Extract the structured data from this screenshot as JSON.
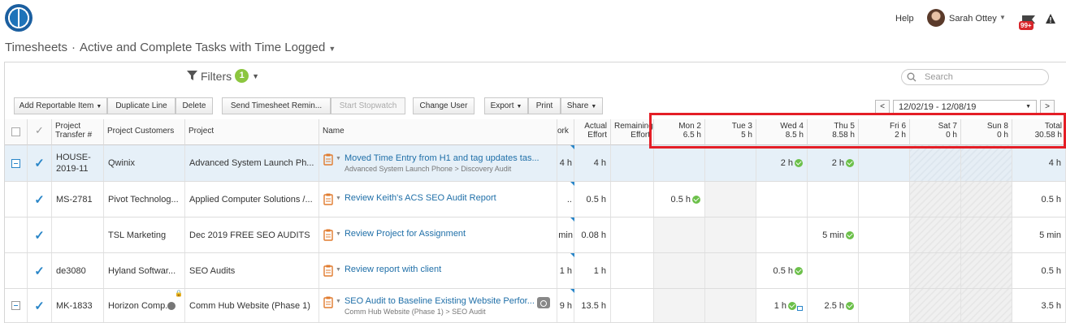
{
  "header": {
    "help": "Help",
    "user_name": "Sarah Ottey",
    "notif_badge": "99+"
  },
  "title": {
    "main": "Timesheets",
    "sep": "·",
    "view": "Active and Complete Tasks with Time Logged"
  },
  "filters": {
    "label": "Filters",
    "count": "1"
  },
  "search": {
    "placeholder": "Search"
  },
  "toolbar": {
    "add_reportable": "Add Reportable Item",
    "duplicate": "Duplicate Line",
    "delete": "Delete",
    "send_reminder": "Send Timesheet Remin...",
    "start_stopwatch": "Start Stopwatch",
    "change_user": "Change User",
    "export": "Export",
    "print": "Print",
    "share": "Share"
  },
  "date_range": {
    "value": "12/02/19 - 12/08/19",
    "prev": "<",
    "next": ">"
  },
  "columns": {
    "transfer": "Project Transfer #",
    "customers": "Project Customers",
    "project": "Project",
    "name": "Name",
    "work": "ork",
    "actual": "Actual Effort",
    "remaining": "Remaining Effort",
    "days": [
      {
        "day": "Mon 2",
        "hours": "6.5 h"
      },
      {
        "day": "Tue 3",
        "hours": "5 h"
      },
      {
        "day": "Wed 4",
        "hours": "8.5 h"
      },
      {
        "day": "Thu 5",
        "hours": "8.58 h"
      },
      {
        "day": "Fri 6",
        "hours": "2 h"
      },
      {
        "day": "Sat 7",
        "hours": "0 h"
      },
      {
        "day": "Sun 8",
        "hours": "0 h"
      },
      {
        "day": "Total",
        "hours": "30.58 h"
      }
    ]
  },
  "rows": [
    {
      "transfer": "HOUSE-2019-11",
      "customer": "Qwinix",
      "project": "Advanced System Launch Ph...",
      "name": "Moved Time Entry from H1 and tag updates tas...",
      "sub": "Advanced System Launch Phone > Discovery Audit",
      "work": "4 h",
      "actual": "4 h",
      "remaining": "",
      "days": [
        "",
        "",
        "2 h",
        "2 h",
        "",
        "",
        ""
      ],
      "total": "4 h"
    },
    {
      "transfer": "MS-2781",
      "customer": "Pivot Technolog...",
      "project": "Applied Computer Solutions /...",
      "name": "Review Keith's ACS SEO Audit Report",
      "sub": "",
      "work": "..",
      "actual": "0.5 h",
      "remaining": "",
      "days": [
        "0.5 h",
        "",
        "",
        "",
        "",
        "",
        ""
      ],
      "total": "0.5 h"
    },
    {
      "transfer": "",
      "customer": "TSL Marketing",
      "project": "Dec 2019 FREE SEO AUDITS",
      "name": "Review Project for Assignment",
      "sub": "",
      "work": "min",
      "actual": "0.08 h",
      "remaining": "",
      "days": [
        "",
        "",
        "",
        "5 min",
        "",
        "",
        ""
      ],
      "total": "5 min"
    },
    {
      "transfer": "de3080",
      "customer": "Hyland Softwar...",
      "project": "SEO Audits",
      "name": "Review report with client",
      "sub": "",
      "work": "1 h",
      "actual": "1 h",
      "remaining": "",
      "days": [
        "",
        "",
        "0.5 h",
        "",
        "",
        "",
        ""
      ],
      "total": "0.5 h"
    },
    {
      "transfer": "MK-1833",
      "customer": "Horizon Comp...",
      "project": "Comm Hub Website (Phase 1)",
      "name": "SEO Audit to Baseline Existing Website Perfor...",
      "sub": "Comm Hub Website (Phase 1) > SEO Audit",
      "work": "9 h",
      "actual": "13.5 h",
      "remaining": "",
      "days": [
        "",
        "",
        "1 h",
        "2.5 h",
        "",
        "",
        ""
      ],
      "total": "3.5 h"
    }
  ]
}
